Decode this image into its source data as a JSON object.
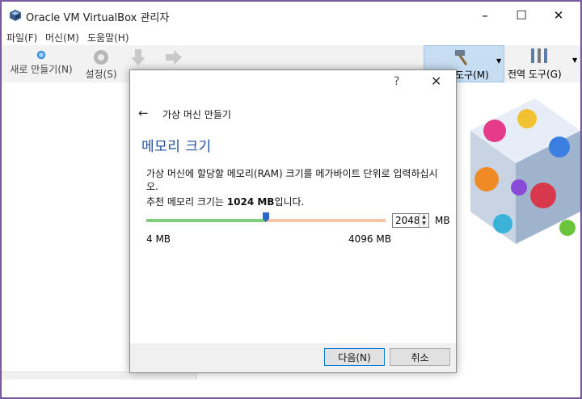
{
  "window": {
    "title": "Oracle VM VirtualBox 관리자",
    "minimize_glyph": "–",
    "maximize_glyph": "☐",
    "close_glyph": "✕"
  },
  "menu": {
    "items": [
      "파일(F)",
      "머신(M)",
      "도움말(H)"
    ]
  },
  "toolbar": {
    "new_label": "새로 만들기(N)",
    "settings_label": "설정(S)",
    "tools_label": "도구(M)",
    "global_tools_label": "전역 도구(G)"
  },
  "dialog": {
    "help_glyph": "?",
    "close_glyph": "✕",
    "back_glyph": "←",
    "title": "가상 머신 만들기",
    "section_title": "메모리 크기",
    "description": "가상 머신에 할당할 메모리(RAM) 크기를 메가바이트 단위로 입력하십시오.",
    "recommend_prefix": "추천 메모리 크기는 ",
    "recommend_value": "1024 MB",
    "recommend_suffix": "입니다.",
    "memory_value": "2048",
    "memory_unit": "MB",
    "min_label": "4 MB",
    "max_label": "4096 MB",
    "next_label": "다음(N)",
    "cancel_label": "취소"
  },
  "slider": {
    "min": 4,
    "max": 4096,
    "value": 2048,
    "safe_fraction": 0.5,
    "colors": {
      "safe": "#7ed07e",
      "warn": "#f4c3a8",
      "thumb": "#2a68c8"
    }
  },
  "colors": {
    "accent": "#1f4fa0",
    "tools_bg": "#c7ddf2",
    "frame": "#6b4d96"
  }
}
